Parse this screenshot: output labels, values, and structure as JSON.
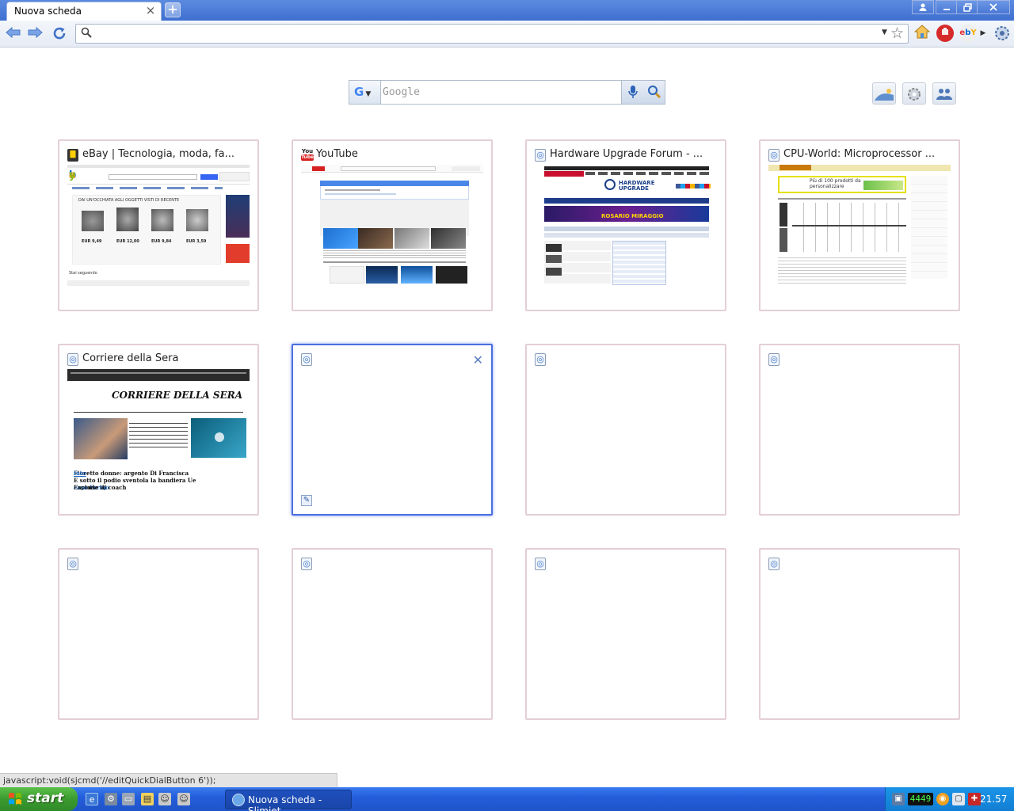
{
  "window": {
    "tab_title": "Nuova scheda",
    "tab_close": "×",
    "new_tab": "+"
  },
  "toolbar": {
    "url_value": "",
    "icons": [
      "back-arrow-icon",
      "forward-arrow-icon",
      "reload-icon",
      "search-icon",
      "star-icon",
      "home-icon",
      "adblock-icon",
      "ebay-icon",
      "wrench-icon"
    ]
  },
  "search": {
    "engine": "G",
    "placeholder": "Google"
  },
  "speed_dial": [
    {
      "title": "eBay | Tecnologia, moda, fa...",
      "thumb": "ebay"
    },
    {
      "title": "YouTube",
      "thumb": "youtube"
    },
    {
      "title": "Hardware Upgrade Forum - ...",
      "thumb": "hwupgrade"
    },
    {
      "title": "CPU-World: Microprocessor ...",
      "thumb": "cpuworld"
    },
    {
      "title": "Corriere della Sera",
      "thumb": "corriere"
    },
    {
      "title": "",
      "thumb": "empty",
      "selected": true
    },
    {
      "title": "",
      "thumb": "empty"
    },
    {
      "title": "",
      "thumb": "empty"
    },
    {
      "title": "",
      "thumb": "empty"
    },
    {
      "title": "",
      "thumb": "empty"
    },
    {
      "title": "",
      "thumb": "empty"
    },
    {
      "title": "",
      "thumb": "empty"
    }
  ],
  "thumbs": {
    "ebay_header": "Ebay",
    "ebay_heading": "DAI UN'OCCHIATA AGLI OGGETTI VISTI DI RECENTE",
    "ebay_prices": [
      "EUR 9,49",
      "EUR 12,00",
      "EUR 9,84",
      "EUR 3,59"
    ],
    "ebay_footer": "Stai seguendo",
    "yt_logo_top": "You",
    "yt_logo_bottom": "Tube",
    "hw_title": "HARDWARE UPGRADE",
    "hw_banner": "ROSARIO MIRAGGIO",
    "cpu_banner": "Più di 100 prodotti da personalizzare",
    "corriere_masthead": "CORRIERE DELLA SERA",
    "corriere_headline_1": "Fioretto donne: argento Di Francisca",
    "corriere_link": "foto",
    "corriere_headline_2": "E sotto il podio sventola la bandiera Ue",
    "corriere_headline_3": "Esplode il",
    "corriere_link2": "caso Errigo",
    "corriere_headline_4": ": accuse al coach"
  },
  "status": {
    "text": "javascript:void(sjcmd('//editQuickDialButton 6'));"
  },
  "taskbar": {
    "start_label": "start",
    "task_label": "Nuova scheda - Slimjet",
    "clock": "21.57",
    "tray_digits": "4449"
  }
}
